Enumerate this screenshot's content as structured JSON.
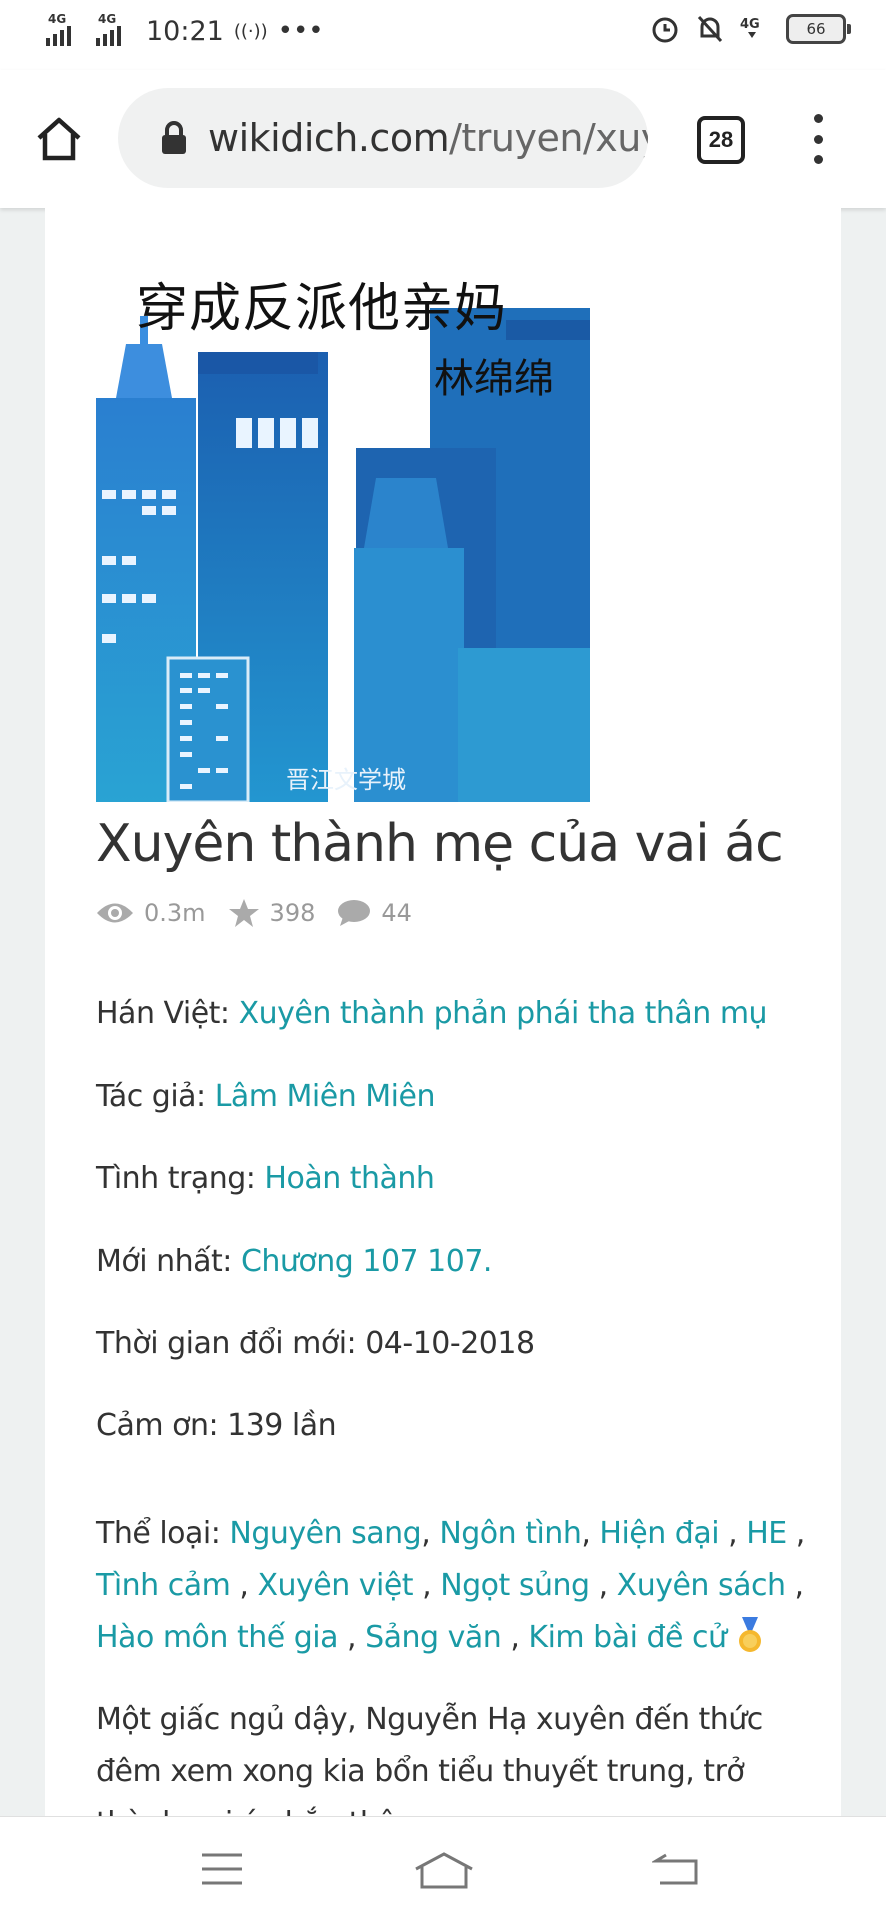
{
  "status_bar": {
    "net1": "4G",
    "net2": "4G",
    "time": "10:21",
    "battery": "66"
  },
  "browser": {
    "url_host": "wikidich.com",
    "url_path": "/truyen/xuye",
    "tab_count": "28"
  },
  "cover": {
    "title_cn": "穿成反派他亲妈",
    "author_cn": "林绵绵",
    "publisher_cn": "晋江文学城"
  },
  "book": {
    "title": "Xuyên thành mẹ của vai ác",
    "views": "0.3m",
    "stars": "398",
    "comments": "44",
    "han_viet_label": "Hán Việt: ",
    "han_viet_value": "Xuyên thành phản phái tha thân mụ",
    "author_label": "Tác giả: ",
    "author_value": "Lâm Miên Miên",
    "status_label": "Tình trạng: ",
    "status_value": "Hoàn thành",
    "latest_label": "Mới nhất: ",
    "latest_value": "Chương 107 107.",
    "updated_label": "Thời gian đổi mới: 04-10-2018",
    "thanks_label": "Cảm ơn: 139 lần",
    "genre_label": "Thể loại: ",
    "genres": [
      "Nguyên sang",
      "Ngôn tình",
      "Hiện đại",
      "HE",
      "Tình cảm",
      "Xuyên việt",
      "Ngọt sủng",
      "Xuyên sách",
      "Hào môn thế gia",
      "Sảng văn",
      "Kim bài đề cử"
    ],
    "description": "Một giấc ngủ dậy, Nguyễn Hạ xuyên đến thức đêm xem xong kia bổn tiểu thuyết trung, trở thành vai ác hắn thân"
  },
  "colors": {
    "link": "#1a9aa5",
    "background": "#eef1f1",
    "cover_blue": "#1f7fc8"
  },
  "icons": {
    "home": "home-icon",
    "lock": "lock-icon",
    "menu": "more-vert-icon",
    "eye": "eye-icon",
    "star": "star-icon",
    "comment": "comment-icon",
    "medal": "medal-icon"
  }
}
